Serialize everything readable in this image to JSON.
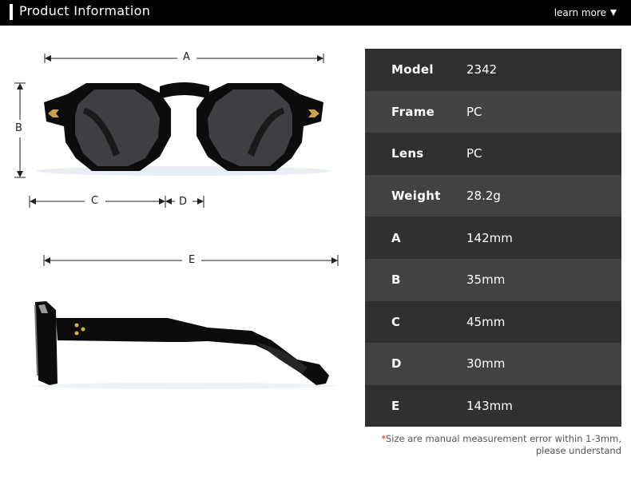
{
  "header": {
    "title": "Product Information",
    "learn_more": "learn more"
  },
  "dimensions": {
    "A": "A",
    "B": "B",
    "C": "C",
    "D": "D",
    "E": "E"
  },
  "specs": [
    {
      "key": "Model",
      "value": "2342"
    },
    {
      "key": "Frame",
      "value": "PC"
    },
    {
      "key": "Lens",
      "value": "PC"
    },
    {
      "key": "Weight",
      "value": "28.2g"
    },
    {
      "key": "A",
      "value": "142mm"
    },
    {
      "key": "B",
      "value": "35mm"
    },
    {
      "key": "C",
      "value": "45mm"
    },
    {
      "key": "D",
      "value": "30mm"
    },
    {
      "key": "E",
      "value": "143mm"
    }
  ],
  "note": {
    "star": "*",
    "line1": "Size are manual measurement error within 1-3mm,",
    "line2": "please understand"
  },
  "colors": {
    "row_dark": "#303030",
    "row_light": "#424242",
    "note_star": "#e02020"
  }
}
